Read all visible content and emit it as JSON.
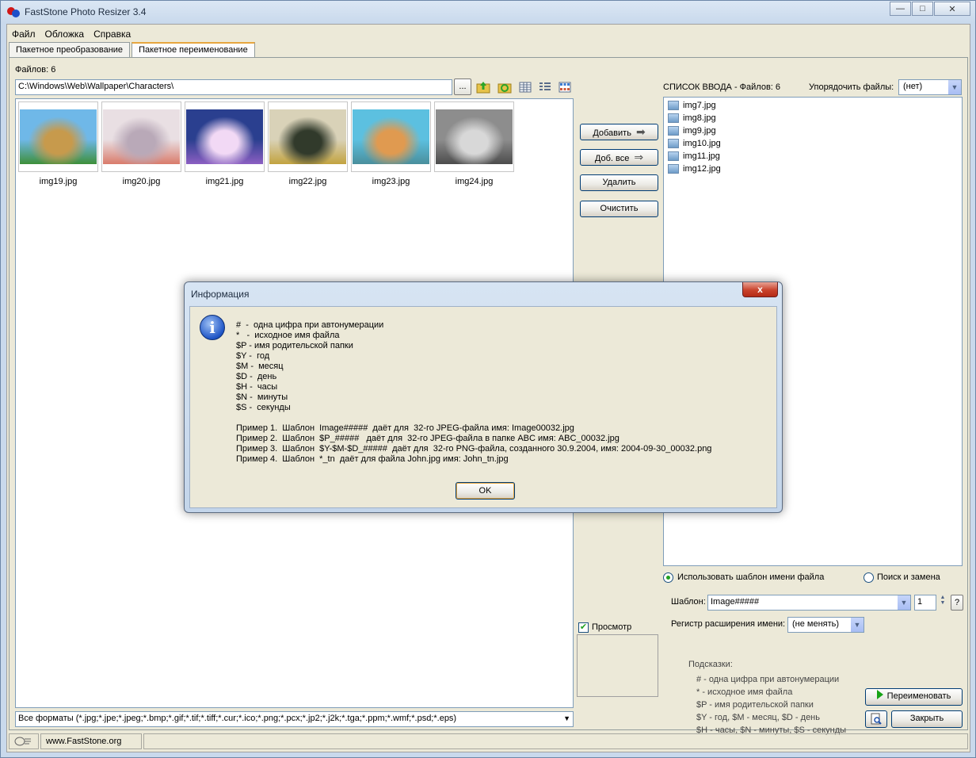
{
  "window": {
    "title": "FastStone Photo Resizer 3.4",
    "min": "—",
    "max": "□",
    "close": "✕"
  },
  "menu": [
    "Файл",
    "Обложка",
    "Справка"
  ],
  "tabs": [
    "Пакетное преобразование",
    "Пакетное переименование"
  ],
  "left": {
    "files_count": "Файлов: 6",
    "path": "C:\\Windows\\Web\\Wallpaper\\Characters\\",
    "browse": "...",
    "thumbnails": [
      {
        "name": "img19.jpg",
        "colors": [
          "#6fb8e8",
          "#c79a4c",
          "#3e8f3a"
        ]
      },
      {
        "name": "img20.jpg",
        "colors": [
          "#e9dfe3",
          "#b9a9b8",
          "#d97b6b"
        ]
      },
      {
        "name": "img21.jpg",
        "colors": [
          "#2a3f8f",
          "#f2d9f5",
          "#8c5fc2"
        ]
      },
      {
        "name": "img22.jpg",
        "colors": [
          "#d9d2b8",
          "#313a2b",
          "#c2a340"
        ]
      },
      {
        "name": "img23.jpg",
        "colors": [
          "#5cc0e0",
          "#e09a50",
          "#4a8f9c"
        ]
      },
      {
        "name": "img24.jpg",
        "colors": [
          "#8d8d8d",
          "#d8d8d8",
          "#4c4c4c"
        ]
      }
    ],
    "format_filter": "Все форматы (*.jpg;*.jpe;*.jpeg;*.bmp;*.gif;*.tif;*.tiff;*.cur;*.ico;*.png;*.pcx;*.jp2;*.j2k;*.tga;*.ppm;*.wmf;*.psd;*.eps)"
  },
  "middle": {
    "add": "Добавить",
    "add_all": "Доб. все",
    "remove": "Удалить",
    "clear": "Очистить",
    "preview": "Просмотр"
  },
  "right": {
    "list_header": "СПИСОК ВВОДА  -  Файлов: 6",
    "sort_label": "Упорядочить файлы:",
    "sort_value": "(нет)",
    "files": [
      "img7.jpg",
      "img8.jpg",
      "img9.jpg",
      "img10.jpg",
      "img11.jpg",
      "img12.jpg"
    ],
    "use_template": "Использовать шаблон имени файла",
    "search_replace": "Поиск и замена",
    "template_label": "Шаблон:",
    "template_value": "Image#####",
    "start_number": "1",
    "help": "?",
    "ext_case_label": "Регистр расширения имени:",
    "ext_case_value": "(не менять)",
    "hints_title": "Подсказки:",
    "hints": [
      "#   - одна цифра при автонумерации",
      "*   - исходное имя файла",
      "$P - имя родительской папки",
      "$Y - год,     $M - месяц,    $D - день",
      "$H - часы,  $N - минуты,  $S - секунды"
    ],
    "rename": "Переименовать",
    "close": "Закрыть"
  },
  "status": {
    "site": "www.FastStone.org"
  },
  "dialog": {
    "title": "Информация",
    "close": "x",
    "icon": "i",
    "lines": [
      "#  -  одна цифра при автонумерации",
      "*   -  исходное имя файла",
      "$P - имя родительской папки",
      "$Y -  год",
      "$M -  месяц",
      "$D -  день",
      "$H -  часы",
      "$N -  минуты",
      "$S -  секунды",
      "",
      "Пример 1.  Шаблон  Image#####  даёт для  32-го JPEG-файла имя: Image00032.jpg",
      "Пример 2.  Шаблон  $P_#####   даёт для  32-го JPEG-файла в папке ABC имя: ABC_00032.jpg",
      "Пример 3.  Шаблон  $Y-$M-$D_#####  даёт для  32-го PNG-файла, созданного 30.9.2004, имя: 2004-09-30_00032.png",
      "Пример 4.  Шаблон  *_tn  даёт для файла John.jpg имя: John_tn.jpg"
    ],
    "ok": "OK"
  }
}
